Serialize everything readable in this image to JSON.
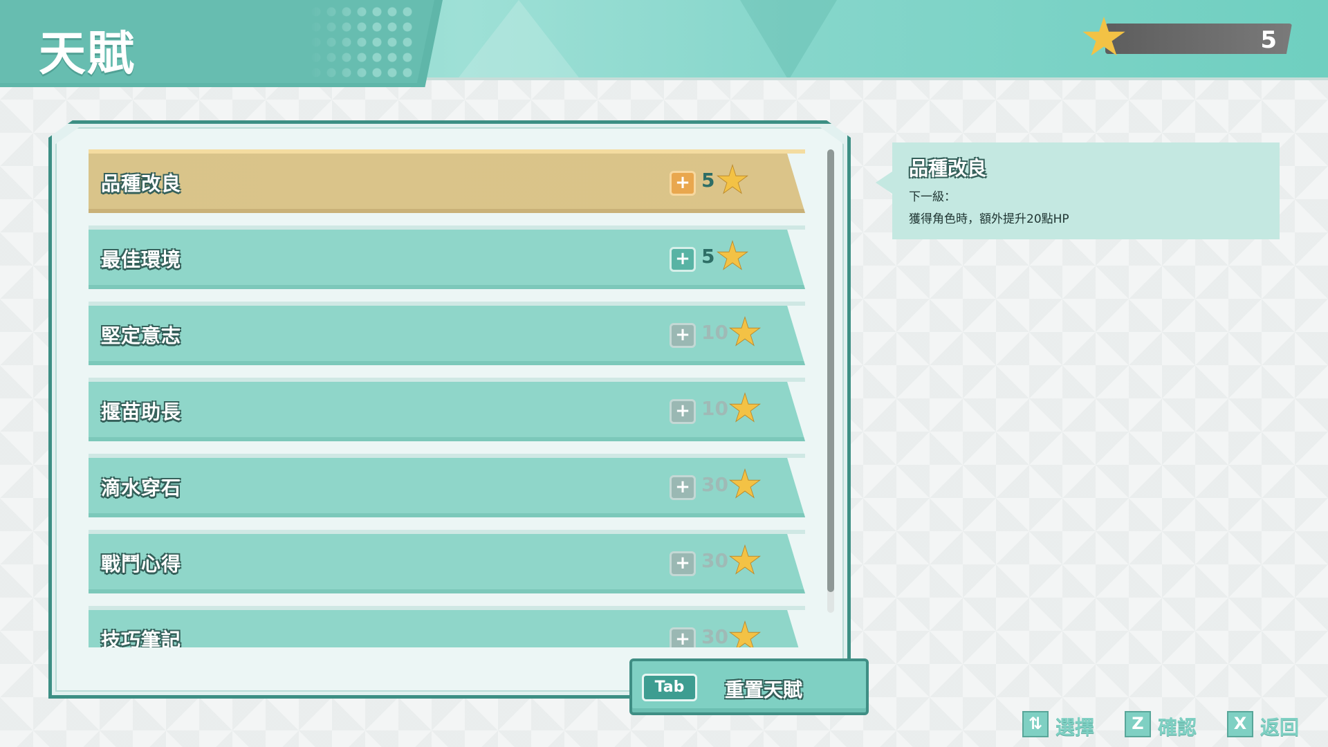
{
  "header": {
    "title": "天賦",
    "points": "5"
  },
  "talents": [
    {
      "name": "品種改良",
      "cost": "5",
      "available": true,
      "selected": true
    },
    {
      "name": "最佳環境",
      "cost": "5",
      "available": true,
      "selected": false
    },
    {
      "name": "堅定意志",
      "cost": "10",
      "available": false,
      "selected": false
    },
    {
      "name": "揠苗助長",
      "cost": "10",
      "available": false,
      "selected": false
    },
    {
      "name": "滴水穿石",
      "cost": "30",
      "available": false,
      "selected": false
    },
    {
      "name": "戰鬥心得",
      "cost": "30",
      "available": false,
      "selected": false
    },
    {
      "name": "技巧筆記",
      "cost": "30",
      "available": false,
      "selected": false
    }
  ],
  "reset": {
    "key": "Tab",
    "label": "重置天賦"
  },
  "detail": {
    "title": "品種改良",
    "next_level_label": "下一級：",
    "description": "獲得角色時，額外提升20點HP"
  },
  "footer": {
    "select": {
      "key": "⇅",
      "label": "選擇"
    },
    "confirm": {
      "key": "Z",
      "label": "確認"
    },
    "back": {
      "key": "X",
      "label": "返回"
    }
  },
  "icons": {
    "points": "star-icon",
    "plus": "plus-icon",
    "cost": "star-icon"
  },
  "colors": {
    "accent": "#7fd0c3",
    "selected_row": "#d9c48a",
    "star": "#f3c245"
  }
}
